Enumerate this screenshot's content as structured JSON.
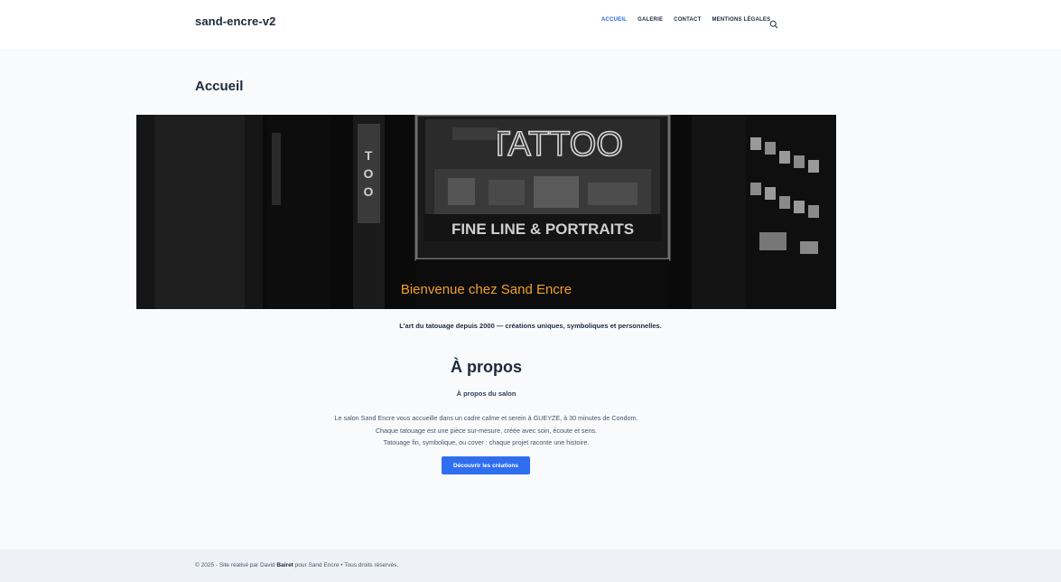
{
  "header": {
    "site_title": "sand-encre-v2",
    "nav": [
      "ACCUEIL",
      "GALERIE",
      "CONTACT",
      "MENTIONS LÉGALES"
    ],
    "active_nav": "ACCUEIL",
    "search_icon": "search-icon"
  },
  "main": {
    "page_title": "Accueil",
    "hero": {
      "caption": "Bienvenue chez Sand Encre",
      "sign_text": "TATTOO",
      "window_text": "FINE LINE & PORTRAITS",
      "caption_color": "#f59e2a"
    },
    "tagline": "L'art du tatouage depuis 2000 — créations uniques, symboliques et personnelles.",
    "about": {
      "title": "À propos",
      "subtitle": "À propos du salon",
      "lines": [
        "Le salon Sand Encre vous accueille dans un cadre calme et serein à GUEYZE, à 30 minutes de Condom.",
        "Chaque tatouage est une pièce sur-mesure, créée avec soin, écoute et sens.",
        "Tatouage fin, symbolique, ou cover : chaque projet raconte une histoire."
      ],
      "cta_label": "Découvrir les créations",
      "cta_color": "#2f6fef"
    }
  },
  "footer": {
    "prefix": "© 2025 - Site réalisé par David ",
    "author": "Bairet",
    "suffix": " pour Sand Encre • Tous droits réservés."
  }
}
